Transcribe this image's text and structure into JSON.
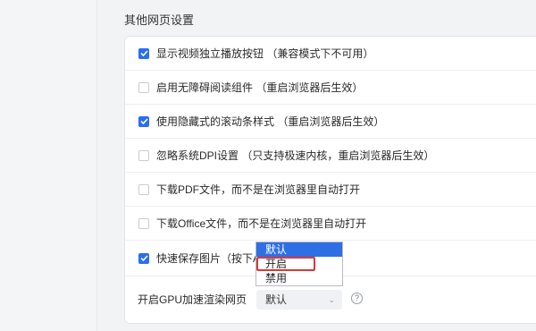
{
  "section": {
    "title": "其他网页设置"
  },
  "settings": [
    {
      "label": "显示视频独立播放按钮 （兼容模式下不可用）",
      "checked": true
    },
    {
      "label": "启用无障碍阅读组件 （重启浏览器后生效）",
      "checked": false
    },
    {
      "label": "使用隐藏式的滚动条样式 （重启浏览器后生效）",
      "checked": true
    },
    {
      "label": "忽略系统DPI设置 （只支持极速内核，重启浏览器后生效）",
      "checked": false
    },
    {
      "label": "下载PDF文件，而不是在浏览器里自动打开",
      "checked": false
    },
    {
      "label": "下载Office文件，而不是在浏览器里自动打开",
      "checked": false
    },
    {
      "label": "快速保存图片（按下Al",
      "checked": true
    }
  ],
  "gpu": {
    "label": "开启GPU加速渲染网页",
    "selected_value": "默认",
    "help_icon": "question-circle-icon",
    "options": [
      "默认",
      "开启",
      "禁用"
    ],
    "highlighted_option": "开启"
  },
  "colors": {
    "accent": "#2a6ef2",
    "highlight_border": "#d43a3a"
  }
}
